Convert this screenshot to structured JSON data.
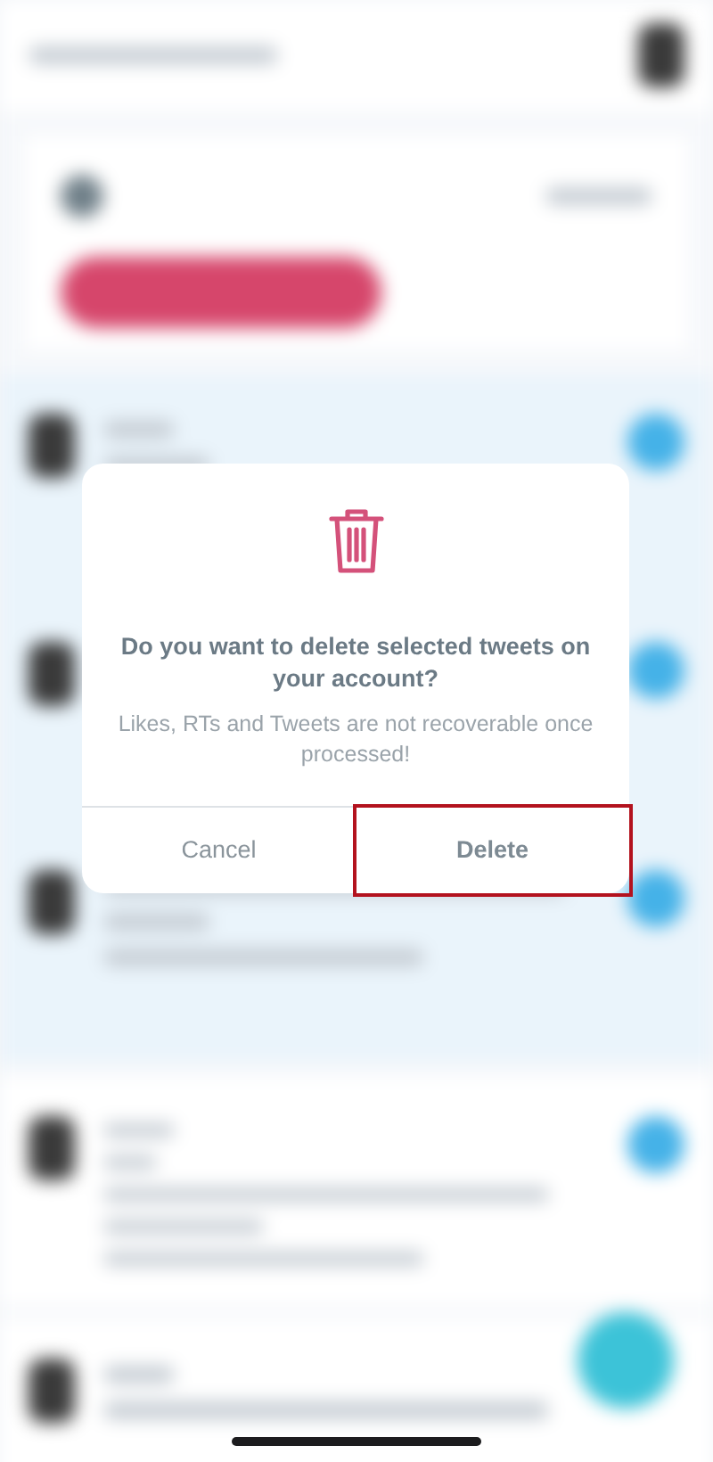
{
  "dialog": {
    "title": "Do you want to delete selected tweets on your account?",
    "message": "Likes, RTs and Tweets are not recoverable once processed!",
    "buttons": [
      {
        "label": "Cancel",
        "kind": "cancel",
        "highlighted": false
      },
      {
        "label": "Delete",
        "kind": "confirm",
        "highlighted": true
      }
    ]
  }
}
